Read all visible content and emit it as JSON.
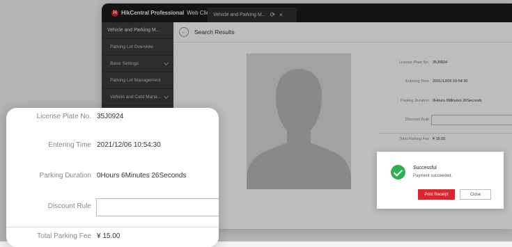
{
  "window": {
    "logo_glyph": "H",
    "brand_bold": "HikCentral Professional",
    "brand_rest": "Web Client",
    "tab_label": "Vehicle and Parking M...",
    "refresh_glyph": "⟳",
    "close_glyph": "×"
  },
  "sidebar": {
    "header": "Vehicle and Parking M...",
    "items": [
      {
        "label": "Parking Lot Overview"
      },
      {
        "label": "Basic Settings"
      },
      {
        "label": "Parking Lot Management"
      },
      {
        "label": "Vehicle and Card Mana..."
      }
    ]
  },
  "main": {
    "back_glyph": "←",
    "title": "Search Results",
    "fields": {
      "plate_label": "License Plate No.",
      "plate_value": "35J0924",
      "entering_label": "Entering Time",
      "entering_value": "2021/12/06 10:54:30",
      "duration_label": "Parking Duration",
      "duration_value": "0Hours 6Minutes 26Seconds",
      "discount_label": "Discount Rule",
      "total_label": "Total Parking Fee",
      "total_value": "¥ 15.00"
    }
  },
  "dialog": {
    "title": "Successful",
    "message": "Payment succeeded.",
    "print_label": "Print Receipt",
    "close_label": "Close"
  },
  "colors": {
    "brand_red": "#e0232c",
    "success_green": "#2fb04f",
    "topbar": "#1c1c1c",
    "sidebar": "#3b3c3e"
  }
}
